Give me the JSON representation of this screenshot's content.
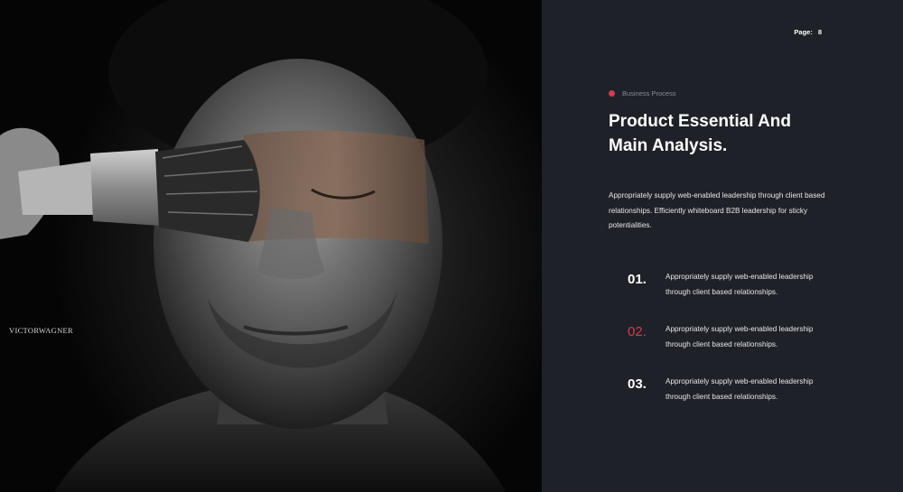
{
  "photo": {
    "watermark": "VICTORWAGNER",
    "subject": "man with eyes closed, paintbrush painting over face"
  },
  "page": {
    "label": "Page:",
    "number": "8"
  },
  "section": {
    "eyebrow": "Business Process",
    "title_line1": "Product Essential And",
    "title_line2": "Main Analysis.",
    "description": "Appropriately supply web-enabled leadership through client based relationships. Efficiently whiteboard B2B leadership for sticky potentialities."
  },
  "items": [
    {
      "number": "01.",
      "text_line1": "Appropriately supply web-enabled leadership",
      "text_line2": "through client based relationships."
    },
    {
      "number": "02.",
      "text_line1": "Appropriately supply web-enabled leadership",
      "text_line2": "through client based relationships."
    },
    {
      "number": "03.",
      "text_line1": "Appropriately supply web-enabled leadership",
      "text_line2": "through client based relationships."
    }
  ],
  "colors": {
    "panel_bg": "#1f2128",
    "accent": "#d23c52",
    "text": "#ffffff",
    "muted": "#8a8d96"
  }
}
